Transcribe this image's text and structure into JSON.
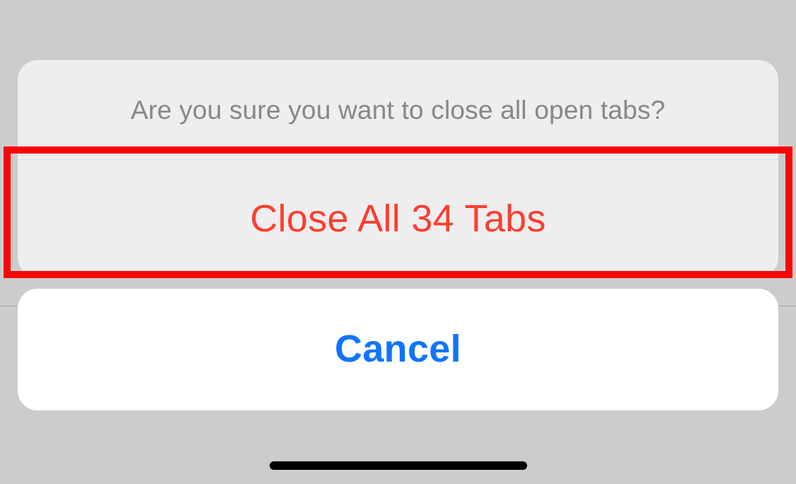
{
  "dialog": {
    "prompt": "Are you sure you want to close all open tabs?",
    "destructive_label": "Close All 34 Tabs",
    "cancel_label": "Cancel",
    "tab_count": 34
  },
  "colors": {
    "destructive": "#fc3e30",
    "primary": "#0f74ff",
    "highlight": "#fc0404"
  }
}
